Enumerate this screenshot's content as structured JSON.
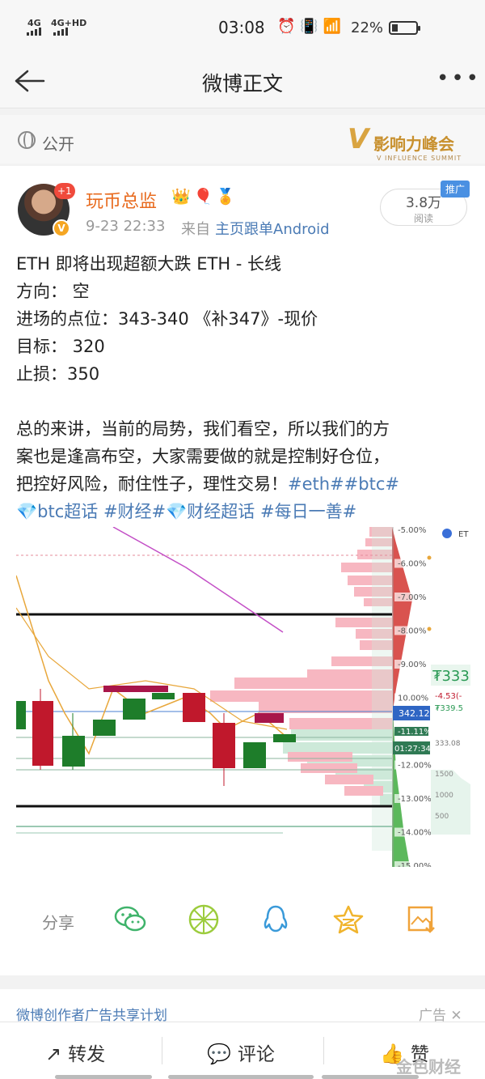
{
  "status_bar": {
    "signal_1": "4G",
    "signal_2": "4G+HD",
    "time": "03:08",
    "battery": "22%"
  },
  "nav": {
    "title": "微博正文",
    "more": "•••"
  },
  "post_meta": {
    "visibility": "公开",
    "summit_v": "V",
    "summit_title": "影响力峰会",
    "summit_sub": "V INFLUENCE SUMMIT"
  },
  "author": {
    "name": "玩币总监",
    "badge_count": "+1",
    "verified_mark": "V",
    "medals": "👑🎈🏅",
    "time": "9-23 22:33",
    "source_prefix": "来自",
    "source": "主页跟单Android"
  },
  "reads": {
    "count": "3.8万",
    "label": "阅读",
    "promo": "推广"
  },
  "content": {
    "lines": [
      "ETH  即将出现超额大跌      ETH - 长线",
      "方向：  空",
      "进场的点位：343-340 《补347》-现价",
      "目标：  320",
      "止损：350",
      "",
      "总的来讲，当前的局势，我们看空，所以我们的方",
      "案也是逢高布空，大家需要做的就是控制好仓位，"
    ],
    "line_9_text": "把控好风险，耐住性子，理性交易！",
    "tag_eth_btc": "#eth##btc#",
    "tag_btc_super": "💎btc超话",
    "tag_finance": "#财经#",
    "tag_finance_super": "💎财经超话",
    "tag_daily": "#每日一善#"
  },
  "chart_image": {
    "symbol_short": "ET",
    "price_label": "342.12",
    "timer_label": "01:27:34",
    "pct_labels": [
      "-5.00%",
      "-6.00%",
      "-7.00%",
      "-8.00%",
      "-9.00%",
      "10.00%",
      "-11.11%",
      "-12.00%",
      "-13.00%",
      "-14.00%",
      "-15.00%"
    ],
    "side_price": "333",
    "side_change": "-4.53(-",
    "side_sub": "339.5",
    "side_low": "333.08",
    "side_vols": [
      "1500",
      "1000",
      "500"
    ],
    "colors": {
      "up": "#1e7d2a",
      "down": "#c0182c",
      "ask": "#f7b7c1",
      "bid": "#cde9d9",
      "accent": "#4a7fd0"
    }
  },
  "share": {
    "label": "分享",
    "icons": [
      "wechat-icon",
      "moments-icon",
      "qq-icon",
      "qzone-icon",
      "save-image-icon"
    ]
  },
  "ad": {
    "text": "微博创作者广告共享计划",
    "mark": "广告 ✕"
  },
  "actions": {
    "repost": "转发",
    "comment": "评论",
    "like": "赞"
  },
  "watermark": "金色财经"
}
